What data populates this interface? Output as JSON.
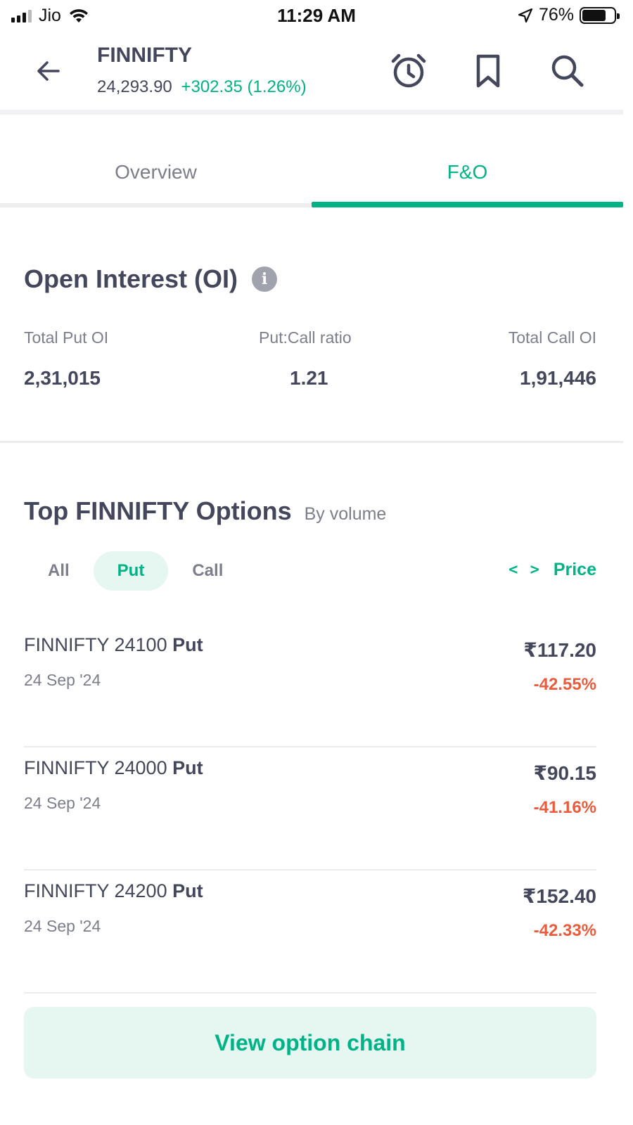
{
  "status_bar": {
    "carrier": "Jio",
    "time": "11:29 AM",
    "battery": "76%",
    "battery_level": 0.76
  },
  "header": {
    "title": "FINNIFTY",
    "price": "24,293.90",
    "change": "+302.35 (1.26%)",
    "icons": [
      "back-arrow-icon",
      "alarm-icon",
      "bookmark-icon",
      "search-icon"
    ]
  },
  "tabs": [
    {
      "label": "Overview",
      "active": false
    },
    {
      "label": "F&O",
      "active": true
    }
  ],
  "open_interest": {
    "title": "Open Interest (OI)",
    "info_glyph": "i",
    "total_put_label": "Total Put OI",
    "total_put_value": "2,31,015",
    "pcr_label": "Put:Call ratio",
    "pcr_value": "1.21",
    "total_call_label": "Total Call OI",
    "total_call_value": "1,91,446"
  },
  "top_options": {
    "title": "Top FINNIFTY Options",
    "subtitle": "By volume",
    "filters": [
      {
        "label": "All",
        "active": false
      },
      {
        "label": "Put",
        "active": true
      },
      {
        "label": "Call",
        "active": false
      }
    ],
    "sort_icon": "< >",
    "sort_label": "Price",
    "rows": [
      {
        "name": "FINNIFTY 24100",
        "type": "Put",
        "expiry": "24 Sep '24",
        "price": "₹117.20",
        "change": "-42.55%"
      },
      {
        "name": "FINNIFTY 24000",
        "type": "Put",
        "expiry": "24 Sep '24",
        "price": "₹90.15",
        "change": "-41.16%"
      },
      {
        "name": "FINNIFTY 24200",
        "type": "Put",
        "expiry": "24 Sep '24",
        "price": "₹152.40",
        "change": "-42.33%"
      }
    ],
    "cta_label": "View option chain"
  },
  "colors": {
    "accent": "#00b386",
    "negative": "#eb5b3c",
    "text": "#44475b",
    "muted": "#7c7e8c"
  }
}
